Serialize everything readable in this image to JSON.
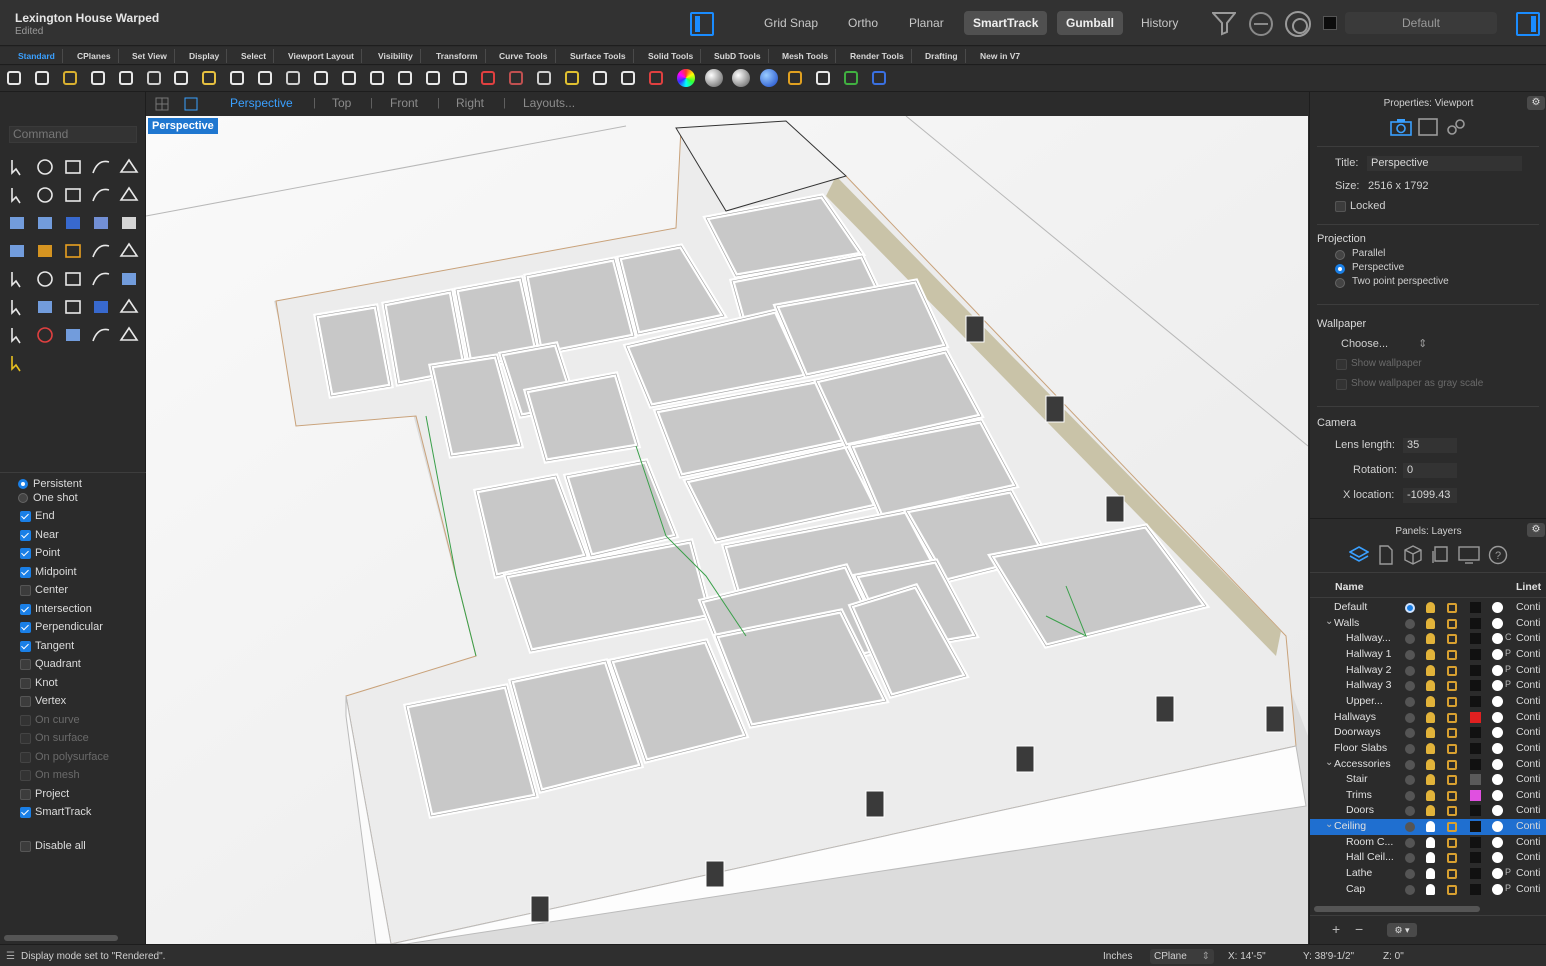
{
  "titlebar": {
    "title": "Lexington House Warped",
    "subtitle": "Edited",
    "buttons": [
      {
        "label": "Grid Snap",
        "on": false
      },
      {
        "label": "Ortho",
        "on": false
      },
      {
        "label": "Planar",
        "on": false
      },
      {
        "label": "SmartTrack",
        "on": true
      },
      {
        "label": "Gumball",
        "on": true
      },
      {
        "label": "History",
        "on": false
      }
    ],
    "current_layer": "Default",
    "accent": "#1a8cff"
  },
  "toolbar_tabs": [
    "Standard",
    "CPlanes",
    "Set View",
    "Display",
    "Select",
    "Viewport Layout",
    "Visibility",
    "Transform",
    "Curve Tools",
    "Surface Tools",
    "Solid Tools",
    "SubD Tools",
    "Mesh Tools",
    "Render Tools",
    "Drafting",
    "New in V7"
  ],
  "active_tab": "Standard",
  "standard_tools": [
    "new-file-icon",
    "open-file-icon",
    "save-icon",
    "print-icon",
    "import-icon",
    "cut-icon",
    "copy-icon",
    "paste-icon",
    "undo-icon",
    "pan-icon",
    "rotate-view-icon",
    "zoom-icon",
    "zoom-window-icon",
    "zoom-extents-icon",
    "zoom-selected-icon",
    "undo-view-icon",
    "four-viewports-icon",
    "car-icon",
    "car-shaded-icon",
    "render-preview-icon",
    "points-icon",
    "light-icon",
    "lock-icon",
    "materials-icon",
    "color-wheel-icon",
    "render-sphere-icon",
    "rendered-sphere-icon",
    "blue-sphere-icon",
    "flag-icon",
    "dimension-icon",
    "globe-icon",
    "help-icon"
  ],
  "viewport_tabs": [
    "Perspective",
    "Top",
    "Front",
    "Right",
    "Layouts..."
  ],
  "active_viewport": "Perspective",
  "command": {
    "placeholder": "Command"
  },
  "left_tools": [
    "select-icon",
    "point-icon",
    "polyline-icon",
    "curve-icon",
    "circle-icon",
    "ellipse-icon",
    "arc-icon",
    "rectangle-icon",
    "polygon-icon",
    "fillet-icon",
    "surface-icon",
    "extrude-icon",
    "box-icon",
    "sphere-icon",
    "cylinder-icon",
    "plane-surface-icon",
    "explode-icon",
    "trim-icon",
    "split-icon",
    "join-icon",
    "boolean-icon",
    "group-icon",
    "array-icon",
    "mirror-icon",
    "text-icon",
    "move-icon",
    "scale-icon",
    "orient-icon",
    "cube-icon",
    "align-icon",
    "grid-icon",
    "mesh-icon",
    "pen-icon",
    "check-icon",
    "analyze-icon",
    "measure-icon"
  ],
  "osnap": {
    "mode_persistent": "Persistent",
    "mode_one_shot": "One shot",
    "items": [
      {
        "label": "End",
        "state": "on"
      },
      {
        "label": "Near",
        "state": "on"
      },
      {
        "label": "Point",
        "state": "on"
      },
      {
        "label": "Midpoint",
        "state": "on"
      },
      {
        "label": "Center",
        "state": "off"
      },
      {
        "label": "Intersection",
        "state": "on"
      },
      {
        "label": "Perpendicular",
        "state": "on"
      },
      {
        "label": "Tangent",
        "state": "on"
      },
      {
        "label": "Quadrant",
        "state": "off"
      },
      {
        "label": "Knot",
        "state": "off"
      },
      {
        "label": "Vertex",
        "state": "off"
      },
      {
        "label": "On curve",
        "state": "dim"
      },
      {
        "label": "On surface",
        "state": "dim"
      },
      {
        "label": "On polysurface",
        "state": "dim"
      },
      {
        "label": "On mesh",
        "state": "dim"
      },
      {
        "label": "Project",
        "state": "off"
      },
      {
        "label": "SmartTrack",
        "state": "on"
      }
    ],
    "disable_all": "Disable all"
  },
  "viewport_label": "Perspective",
  "properties": {
    "panel_title": "Properties: Viewport",
    "title_label": "Title:",
    "title_value": "Perspective",
    "size_label": "Size:",
    "size_value": "2516 x 1792",
    "locked_label": "Locked",
    "projection_heading": "Projection",
    "projection_options": [
      "Parallel",
      "Perspective",
      "Two point perspective"
    ],
    "projection_selected": "Perspective",
    "wallpaper_heading": "Wallpaper",
    "wallpaper_choose": "Choose...",
    "show_wallpaper": "Show wallpaper",
    "show_gray": "Show wallpaper as gray scale",
    "camera_heading": "Camera",
    "lens_label": "Lens length:",
    "lens_value": "35",
    "rotation_label": "Rotation:",
    "rotation_value": "0",
    "xloc_label": "X location:",
    "xloc_value": "-1099.43"
  },
  "layers": {
    "panel_title": "Panels: Layers",
    "col_name": "Name",
    "col_linetype": "Linet",
    "rows": [
      {
        "name": "Default",
        "indent": 0,
        "current": true,
        "color": "#111111",
        "bulb": "y",
        "line": "Conti",
        "mat": ""
      },
      {
        "name": "Walls",
        "indent": 0,
        "expander": true,
        "color": "#111111",
        "bulb": "y",
        "line": "Conti",
        "mat": ""
      },
      {
        "name": "Hallway...",
        "indent": 1,
        "color": "#111111",
        "bulb": "y",
        "line": "Conti",
        "mat": "C"
      },
      {
        "name": "Hallway 1",
        "indent": 1,
        "color": "#111111",
        "bulb": "y",
        "line": "Conti",
        "mat": "P"
      },
      {
        "name": "Hallway 2",
        "indent": 1,
        "color": "#111111",
        "bulb": "y",
        "line": "Conti",
        "mat": "P"
      },
      {
        "name": "Hallway 3",
        "indent": 1,
        "color": "#111111",
        "bulb": "y",
        "line": "Conti",
        "mat": "P"
      },
      {
        "name": "Upper...",
        "indent": 1,
        "color": "#111111",
        "bulb": "y",
        "line": "Conti",
        "mat": ""
      },
      {
        "name": "Hallways",
        "indent": 0,
        "color": "#e02020",
        "bulb": "y",
        "line": "Conti",
        "mat": ""
      },
      {
        "name": "Doorways",
        "indent": 0,
        "color": "#111111",
        "bulb": "y",
        "line": "Conti",
        "mat": ""
      },
      {
        "name": "Floor Slabs",
        "indent": 0,
        "color": "#111111",
        "bulb": "y",
        "line": "Conti",
        "mat": ""
      },
      {
        "name": "Accessories",
        "indent": 0,
        "expander": true,
        "color": "#111111",
        "bulb": "y",
        "line": "Conti",
        "mat": ""
      },
      {
        "name": "Stair",
        "indent": 1,
        "color": "#5a5a5a",
        "bulb": "y",
        "line": "Conti",
        "mat": ""
      },
      {
        "name": "Trims",
        "indent": 1,
        "color": "#e050e0",
        "bulb": "y",
        "line": "Conti",
        "mat": ""
      },
      {
        "name": "Doors",
        "indent": 1,
        "color": "#111111",
        "bulb": "y",
        "line": "Conti",
        "mat": ""
      },
      {
        "name": "Ceiling",
        "indent": 0,
        "expander": true,
        "selected": true,
        "color": "#111111",
        "bulb": "w",
        "line": "Conti",
        "mat": ""
      },
      {
        "name": "Room C...",
        "indent": 1,
        "color": "#111111",
        "bulb": "w",
        "line": "Conti",
        "mat": ""
      },
      {
        "name": "Hall Ceil...",
        "indent": 1,
        "color": "#111111",
        "bulb": "w",
        "line": "Conti",
        "mat": ""
      },
      {
        "name": "Lathe",
        "indent": 1,
        "color": "#111111",
        "bulb": "w",
        "line": "Conti",
        "mat": "P"
      },
      {
        "name": "Cap",
        "indent": 1,
        "color": "#111111",
        "bulb": "w",
        "line": "Conti",
        "mat": "P"
      }
    ]
  },
  "status": {
    "message": "Display mode set to \"Rendered\".",
    "units": "Inches",
    "cplane": "CPlane",
    "x": "X: 14'-5\"",
    "y": "Y: 38'9-1/2\"",
    "z": "Z: 0\""
  }
}
